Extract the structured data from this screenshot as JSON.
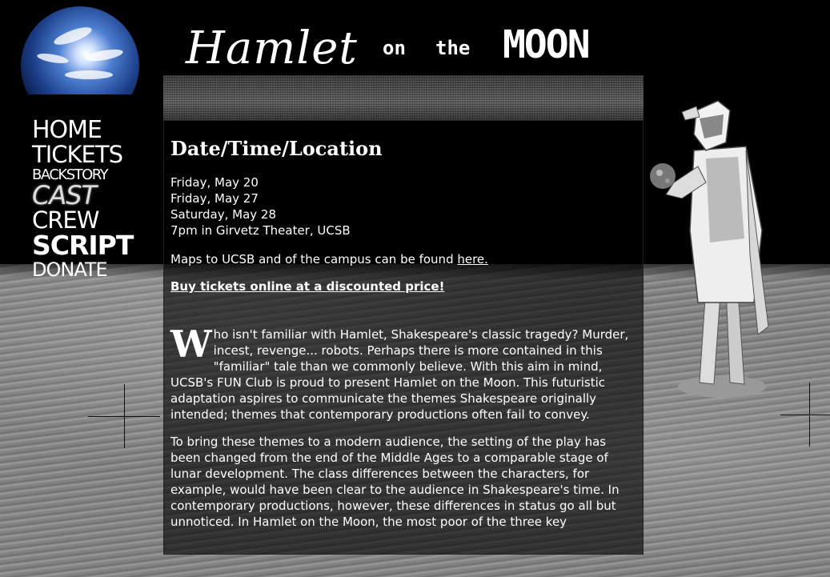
{
  "site": {
    "title_word1": "Hamlet",
    "title_word2": "on",
    "title_word3": "the",
    "title_word4": "MOON"
  },
  "nav": {
    "items": [
      {
        "label": "HOME"
      },
      {
        "label": "TICKETS"
      },
      {
        "label": "BACKSTORY"
      },
      {
        "label": "CAST"
      },
      {
        "label": "CREW"
      },
      {
        "label": "SCRIPT"
      },
      {
        "label": "DONATE"
      }
    ]
  },
  "main": {
    "heading": "Date/Time/Location",
    "dates": [
      "Friday, May 20",
      "Friday, May 27",
      "Saturday, May 28",
      "7pm in Girvetz Theater, UCSB"
    ],
    "maps_text": "Maps to UCSB and of the campus can be found ",
    "maps_link": "here.",
    "buy_link": "Buy tickets online at a discounted price!",
    "intro_dropcap": "W",
    "intro_rest": "ho isn't familiar with Hamlet, Shakespeare's classic tragedy? Murder, incest, revenge... robots. Perhaps there is more contained in this \"familiar\" tale than we commonly believe. With this aim in mind, UCSB's FUN Club is proud to present Hamlet on the Moon. This futuristic adaptation aspires to communicate the themes Shakespeare originally intended; themes that contemporary productions often fail to convey.",
    "para2": "To bring these themes to a modern audience, the setting of the play has been changed from the end of the Middle Ages to a comparable stage of lunar development. The class differences between the characters, for example, would have been clear to the audience in Shakespeare's time. In contemporary productions, however, these differences in status go all but unnoticed. In Hamlet on the Moon, the most poor of the three key"
  },
  "colors": {
    "background": "#000000",
    "text": "#ffffff",
    "moon_surface": "#7c7c7c"
  },
  "icons": {
    "earth": "earth-image",
    "hamlet_figure": "astronaut-hamlet-image"
  }
}
